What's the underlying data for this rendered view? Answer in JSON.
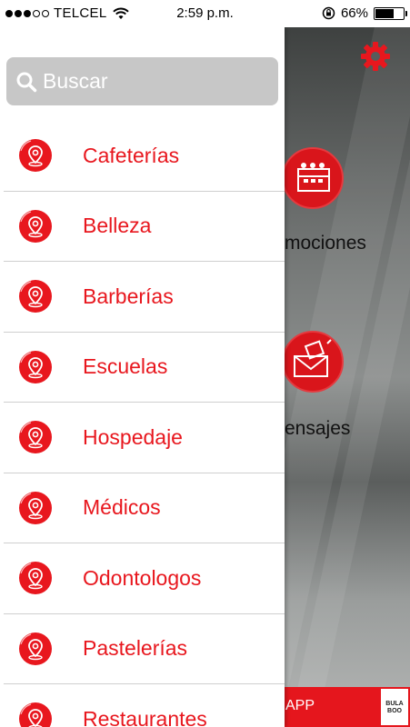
{
  "status_bar": {
    "carrier": "TELCEL",
    "time": "2:59 p.m.",
    "battery_percent": "66%",
    "battery_level": 0.66,
    "signal_bars_filled": 3,
    "signal_bars_total": 5
  },
  "drawer": {
    "search_placeholder": "Buscar",
    "items": [
      {
        "label": "Cafeterías"
      },
      {
        "label": "Belleza"
      },
      {
        "label": "Barberías"
      },
      {
        "label": "Escuelas"
      },
      {
        "label": "Hospedaje"
      },
      {
        "label": "Médicos"
      },
      {
        "label": "Odontologos"
      },
      {
        "label": "Pastelerías"
      },
      {
        "label": "Restaurantes"
      }
    ]
  },
  "background": {
    "promotions_label": "mociones",
    "messages_label": "ensajes",
    "bottom_bar_text": "APP",
    "logo_text_line1": "BULA",
    "logo_text_line2": "BOO"
  },
  "colors": {
    "accent_red": "#e8171e",
    "search_bg": "#c7c7c7"
  },
  "icons": {
    "menu_item_icon": "location-pin-icon",
    "settings": "gear-icon",
    "search": "search-icon",
    "promotions": "calendar-icon",
    "messages": "envelope-icon"
  }
}
